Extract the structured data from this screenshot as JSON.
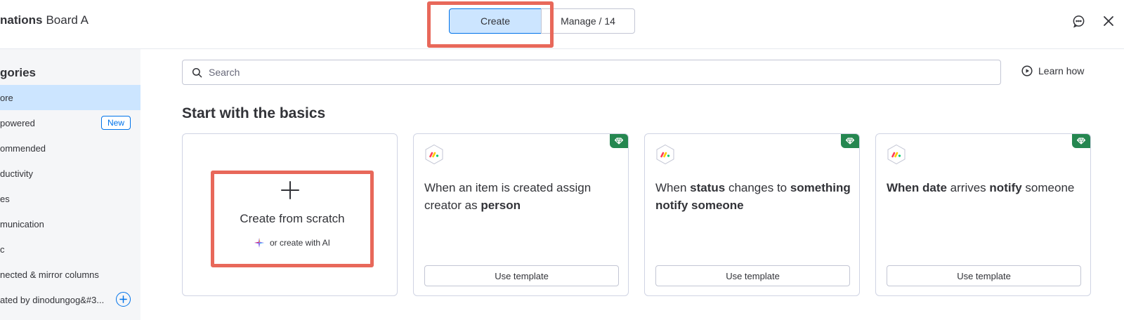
{
  "header": {
    "board_name_bold": "nations",
    "board_name_rest": "Board A",
    "create_tab": "Create",
    "manage_tab": "Manage / 14",
    "feedback_icon": "chat-icon",
    "close_icon": "close-icon"
  },
  "sidebar": {
    "title": "gories",
    "items": [
      {
        "label": "ore",
        "active": true
      },
      {
        "label": "powered",
        "badge": "New"
      },
      {
        "label": "ommended"
      },
      {
        "label": "ductivity"
      },
      {
        "label": "es"
      },
      {
        "label": "munication"
      },
      {
        "label": "c"
      },
      {
        "label": "nected & mirror columns"
      },
      {
        "label": "ated by dinodungog&#3..."
      }
    ]
  },
  "search": {
    "placeholder": "Search"
  },
  "learn_how": "Learn how",
  "section_title": "Start with the basics",
  "scratch_card": {
    "label": "Create from scratch",
    "ai_label": "or create with AI"
  },
  "templates": [
    {
      "parts": [
        {
          "text": "When an item is created assign creator as ",
          "bold": false
        },
        {
          "text": "person",
          "bold": true
        }
      ],
      "button": "Use template"
    },
    {
      "parts": [
        {
          "text": "When ",
          "bold": false
        },
        {
          "text": "status",
          "bold": true
        },
        {
          "text": " changes to ",
          "bold": false
        },
        {
          "text": "something notify someone",
          "bold": true
        }
      ],
      "button": "Use template"
    },
    {
      "parts": [
        {
          "text": "When date",
          "bold": true
        },
        {
          "text": " arrives ",
          "bold": false
        },
        {
          "text": "notify",
          "bold": true
        },
        {
          "text": " someone",
          "bold": false
        }
      ],
      "button": "Use template"
    }
  ],
  "colors": {
    "accent": "#0073ea",
    "selected": "#cce5ff",
    "highlight": "#e8685a",
    "premium": "#258750"
  }
}
